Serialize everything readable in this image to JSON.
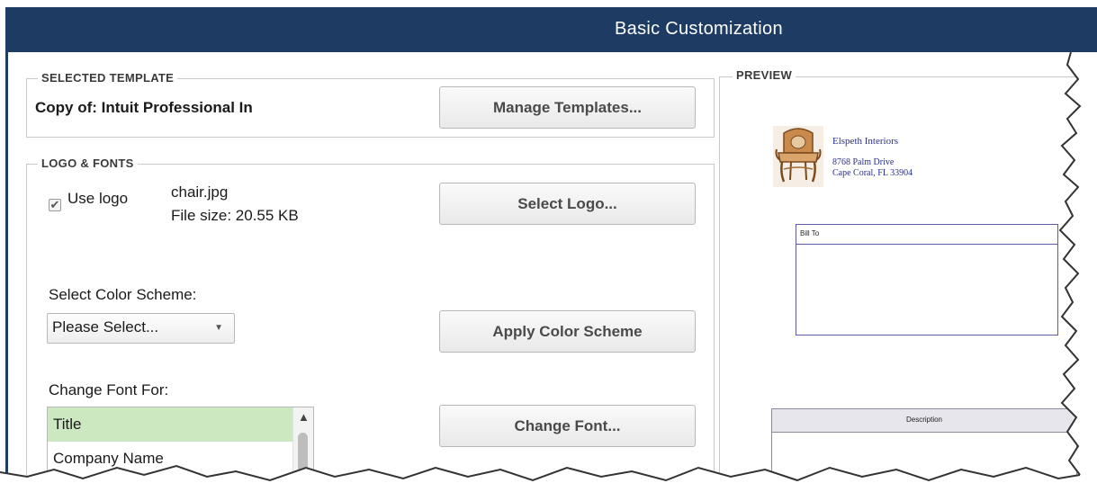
{
  "window": {
    "title": "Basic Customization"
  },
  "selected_template": {
    "section_label": "SELECTED TEMPLATE",
    "template_name": "Copy of: Intuit Professional In",
    "manage_button": "Manage Templates..."
  },
  "logo_fonts": {
    "section_label": "LOGO & FONTS",
    "use_logo_checked": true,
    "use_logo_label": "Use logo",
    "checkmark": "✔",
    "logo_filename": "chair.jpg",
    "logo_filesize": "File size: 20.55 KB",
    "select_logo_button": "Select Logo...",
    "color_scheme_label": "Select Color Scheme:",
    "color_scheme_value": "Please Select...",
    "apply_color_button": "Apply Color Scheme",
    "change_font_label": "Change Font For:",
    "font_items": [
      "Title",
      "Company Name"
    ],
    "selected_font_item": "Title",
    "change_font_button": "Change Font..."
  },
  "preview": {
    "section_label": "PREVIEW",
    "company_name": "Elspeth Interiors",
    "address_line1": "8768 Palm Drive",
    "address_line2": "Cape Coral, FL 33904",
    "bill_to_label": "Bill To",
    "description_label": "Description"
  },
  "colors": {
    "titlebar": "#1e3c63",
    "selected_row": "#cce8c0",
    "preview_text": "#2a2f8a"
  }
}
